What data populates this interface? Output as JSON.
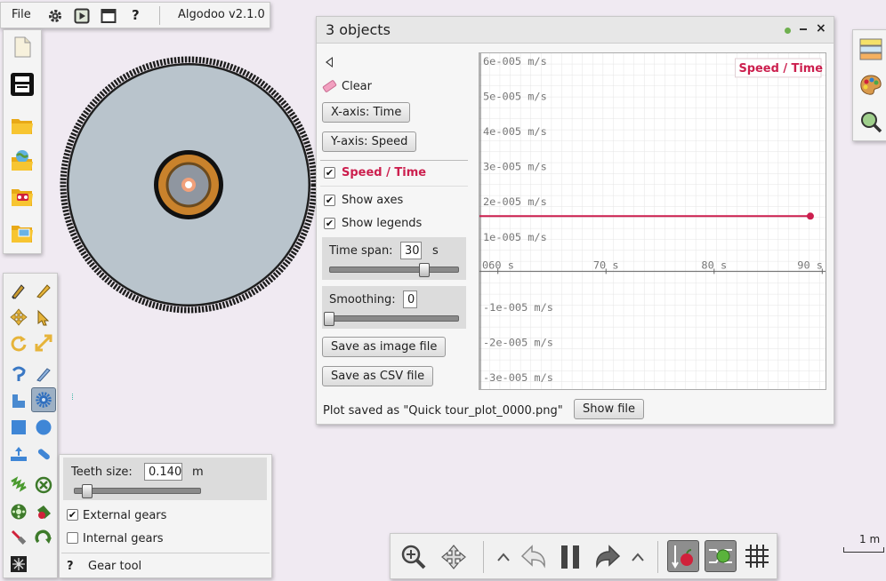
{
  "menubar": {
    "file_label": "File",
    "settings_icon": "gear-icon",
    "play_icon": "play-window-icon",
    "window_icon": "window-icon",
    "help_label": "?",
    "app_title": "Algodoo v2.1.0"
  },
  "plot_window": {
    "title": "3 objects",
    "clear_label": "Clear",
    "xaxis_button": "X-axis: Time",
    "yaxis_button": "Y-axis: Speed",
    "series_checkbox_label": "Speed / Time",
    "show_axes_label": "Show axes",
    "show_legends_label": "Show legends",
    "time_span_label": "Time span:",
    "time_span_value": "30",
    "time_span_unit": "s",
    "time_span_fraction": 0.75,
    "smoothing_label": "Smoothing:",
    "smoothing_value": "0",
    "save_image_label": "Save as image file",
    "save_csv_label": "Save as CSV file",
    "status_text": "Plot saved as \"Quick tour_plot_0000.png\"",
    "show_file_label": "Show file"
  },
  "chart_data": {
    "type": "line",
    "legend": "Speed / Time",
    "legend_position": "top-right",
    "grid": true,
    "xlim": [
      58.3,
      90.3
    ],
    "ylim": [
      -3.35e-05,
      6.2e-05
    ],
    "x_ticks": [
      {
        "value": 60,
        "label": "060 s"
      },
      {
        "value": 70,
        "label": "70 s"
      },
      {
        "value": 80,
        "label": "80 s"
      },
      {
        "value": 90,
        "label": "90 s"
      }
    ],
    "y_ticks": [
      {
        "value": 6e-05,
        "label": "6e-005 m/s"
      },
      {
        "value": 5e-05,
        "label": "5e-005 m/s"
      },
      {
        "value": 4e-05,
        "label": "4e-005 m/s"
      },
      {
        "value": 3e-05,
        "label": "3e-005 m/s"
      },
      {
        "value": 2e-05,
        "label": "2e-005 m/s"
      },
      {
        "value": 1e-05,
        "label": "1e-005 m/s"
      },
      {
        "value": -1e-05,
        "label": "-1e-005 m/s"
      },
      {
        "value": -2e-05,
        "label": "-2e-005 m/s"
      },
      {
        "value": -3e-05,
        "label": "-3e-005 m/s"
      }
    ],
    "series": [
      {
        "color": "#cc1f4e",
        "x": [
          58.3,
          88.9
        ],
        "y": [
          1.57e-05,
          1.57e-05
        ]
      }
    ]
  },
  "gear_panel": {
    "teeth_size_label": "Teeth size:",
    "teeth_size_value": "0.140",
    "teeth_size_unit": "m",
    "teeth_size_fraction": 0.07,
    "external_gears_label": "External gears",
    "internal_gears_label": "Internal gears",
    "tool_name": "Gear tool",
    "help_label": "?"
  },
  "scale_label": "1 m",
  "colors": {
    "accent": "#cc1f4e",
    "background": "#f0eaf2",
    "gear": "#b9c4cc"
  }
}
